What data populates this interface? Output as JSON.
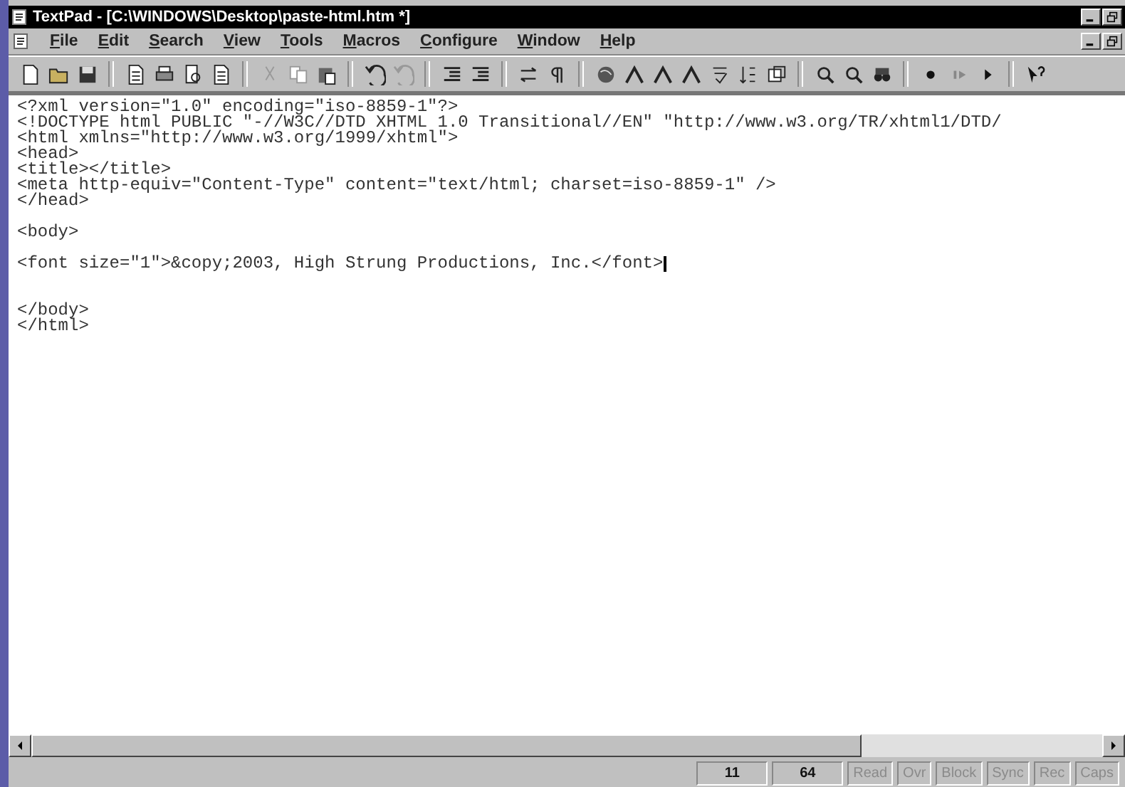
{
  "window": {
    "title": "TextPad - [C:\\WINDOWS\\Desktop\\paste-html.htm *]"
  },
  "menu": [
    "File",
    "Edit",
    "Search",
    "View",
    "Tools",
    "Macros",
    "Configure",
    "Window",
    "Help"
  ],
  "editor": {
    "lines": [
      {
        "kind": "code",
        "text": "<?xml version=\"1.0\" encoding=\"iso-8859-1\"?>",
        "cursor": false
      },
      {
        "kind": "code",
        "text": "<!DOCTYPE html PUBLIC \"-//W3C//DTD XHTML 1.0 Transitional//EN\" \"http://www.w3.org/TR/xhtml1/DTD/",
        "cursor": false
      },
      {
        "kind": "code",
        "text": "<html xmlns=\"http://www.w3.org/1999/xhtml\">",
        "cursor": false
      },
      {
        "kind": "code",
        "text": "<head>",
        "cursor": false
      },
      {
        "kind": "code",
        "text": "<title></title>",
        "cursor": false
      },
      {
        "kind": "code",
        "text": "<meta http-equiv=\"Content-Type\" content=\"text/html; charset=iso-8859-1\" />",
        "cursor": false
      },
      {
        "kind": "code",
        "text": "</head>",
        "cursor": false
      },
      {
        "kind": "blank"
      },
      {
        "kind": "code",
        "text": "<body>",
        "cursor": false
      },
      {
        "kind": "blank"
      },
      {
        "kind": "code",
        "text": "<font size=\"1\">&copy;2003, High Strung Productions, Inc.</font>",
        "cursor": true
      },
      {
        "kind": "blank"
      },
      {
        "kind": "blank"
      },
      {
        "kind": "code",
        "text": "</body>",
        "cursor": false
      },
      {
        "kind": "code",
        "text": "</html>",
        "cursor": false
      }
    ]
  },
  "status_bar": {
    "line": "11",
    "column": "64",
    "indicators": [
      {
        "label": "Read",
        "on": false
      },
      {
        "label": "Ovr",
        "on": false
      },
      {
        "label": "Block",
        "on": false
      },
      {
        "label": "Sync",
        "on": false
      },
      {
        "label": "Rec",
        "on": false
      },
      {
        "label": "Caps",
        "on": false
      }
    ]
  }
}
